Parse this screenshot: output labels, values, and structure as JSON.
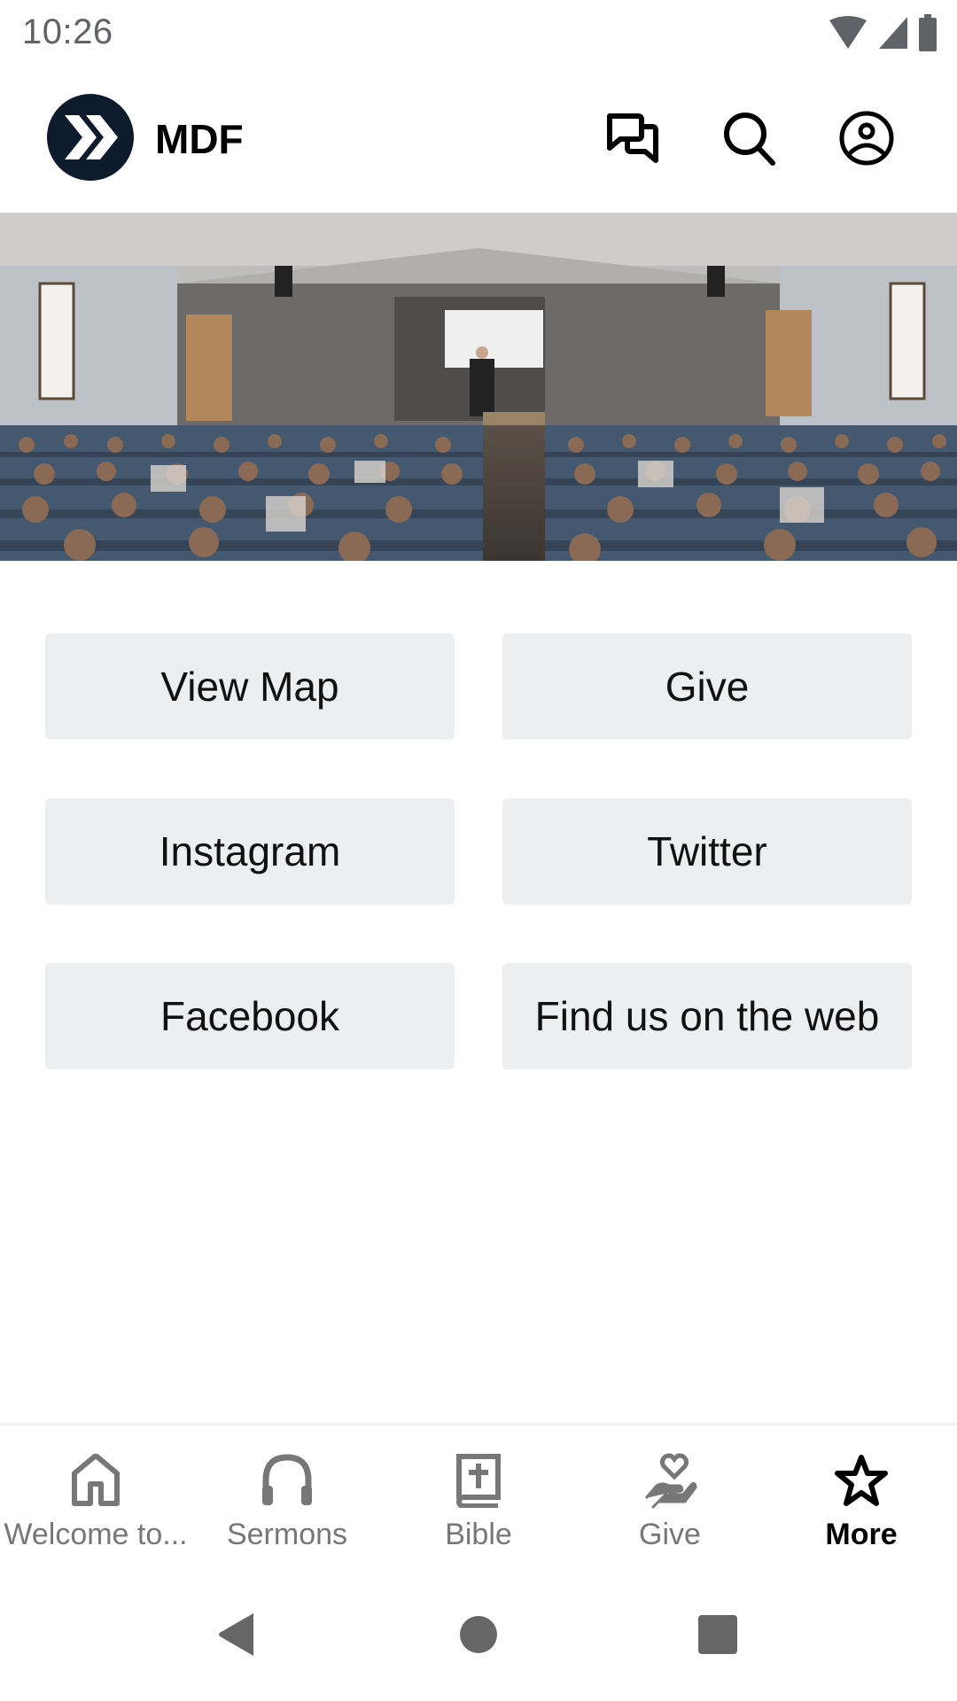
{
  "status_bar": {
    "time": "10:26",
    "icons": [
      "wifi-icon",
      "signal-icon",
      "battery-icon"
    ]
  },
  "header": {
    "app_title": "MDF",
    "logo_icon": "double-chevron-logo",
    "actions": [
      {
        "name": "messages",
        "icon": "chat-bubbles-icon"
      },
      {
        "name": "search",
        "icon": "search-icon"
      },
      {
        "name": "profile",
        "icon": "account-circle-icon"
      }
    ],
    "brand_color": "#0e1b2c"
  },
  "hero": {
    "description": "Church sanctuary with congregation seated facing a stage with speaker at podium and projection screen"
  },
  "buttons": [
    {
      "label": "View Map"
    },
    {
      "label": "Give"
    },
    {
      "label": "Instagram"
    },
    {
      "label": "Twitter"
    },
    {
      "label": "Facebook"
    },
    {
      "label": "Find us on the web"
    }
  ],
  "bottom_nav": {
    "items": [
      {
        "label": "Welcome to...",
        "icon": "home-icon",
        "active": false
      },
      {
        "label": "Sermons",
        "icon": "headphones-icon",
        "active": false
      },
      {
        "label": "Bible",
        "icon": "bible-icon",
        "active": false
      },
      {
        "label": "Give",
        "icon": "giving-hand-heart-icon",
        "active": false
      },
      {
        "label": "More",
        "icon": "star-icon",
        "active": true
      }
    ],
    "inactive_color": "#777777",
    "active_color": "#000000"
  },
  "system_nav": {
    "buttons": [
      "back",
      "home",
      "recents"
    ]
  }
}
